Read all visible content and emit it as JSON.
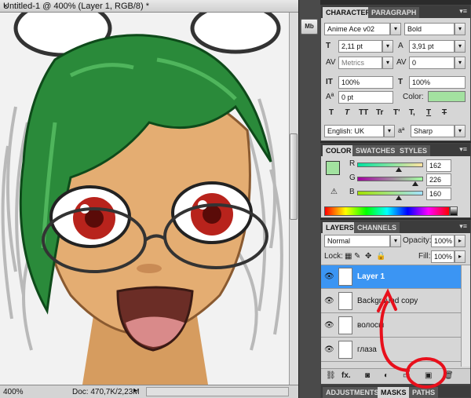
{
  "document": {
    "tab_title": "Untitled-1 @ 400% (Layer 1, RGB/8) *",
    "close_glyph": "×",
    "status_zoom": "400%",
    "status_doc": "Doc: 470,7K/2,23M",
    "status_arrow": "▸"
  },
  "dock": {
    "mb_label": "Mb"
  },
  "character_panel": {
    "tabs": [
      "CHARACTER",
      "PARAGRAPH"
    ],
    "font_family": "Anime Ace v02",
    "font_style": "Bold",
    "font_size": "2,11 pt",
    "leading": "3,91 pt",
    "kerning": "Metrics",
    "tracking": "0",
    "vertical_scale": "100%",
    "horizontal_scale": "100%",
    "baseline_shift": "0 pt",
    "color_label": "Color:",
    "text_color": "#a3e1a0",
    "style_buttons": [
      "T",
      "T",
      "TT",
      "Tr",
      "T'",
      "T,",
      "T",
      "T"
    ],
    "language": "English: UK",
    "aa_label": "a",
    "antialias": "Sharp"
  },
  "color_panel": {
    "tabs": [
      "COLOR",
      "SWATCHES",
      "STYLES"
    ],
    "channels": [
      {
        "label": "R",
        "value": "162",
        "level": 0.635
      },
      {
        "label": "G",
        "value": "226",
        "level": 0.886
      },
      {
        "label": "B",
        "value": "160",
        "level": 0.627
      }
    ],
    "foreground": "#a2e2a0"
  },
  "layers_panel": {
    "tabs": [
      "LAYERS",
      "CHANNELS"
    ],
    "blend_mode": "Normal",
    "opacity_label": "Opacity:",
    "opacity": "100%",
    "lock_label": "Lock:",
    "fill_label": "Fill:",
    "fill": "100%",
    "layers": [
      {
        "name": "Layer 1",
        "active": true
      },
      {
        "name": "Background copy",
        "active": false
      },
      {
        "name": "волосы",
        "active": false
      },
      {
        "name": "глаза",
        "active": false
      }
    ],
    "footer_buttons": [
      "⛓",
      "fx.",
      "◙",
      "◐",
      "▭",
      "▣",
      "🗑"
    ]
  },
  "bottom_tabs": [
    "ADJUSTMENTS",
    "MASKS",
    "PATHS"
  ],
  "annotation_color": "#e8101c"
}
